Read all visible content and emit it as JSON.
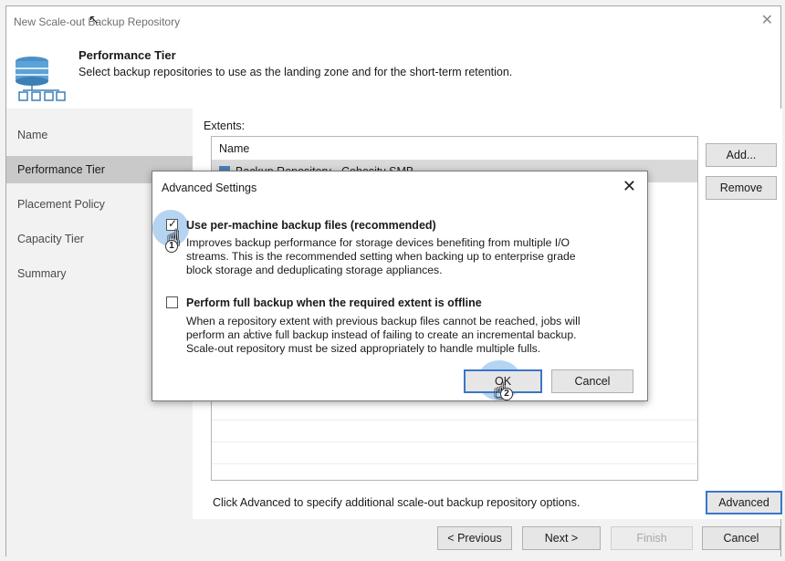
{
  "window": {
    "title": "New Scale-out Backup Repository",
    "close_icon": "close-icon"
  },
  "header": {
    "title": "Performance Tier",
    "subtitle": "Select backup repositories to use as the landing zone and for the short-term retention."
  },
  "sidebar": {
    "items": [
      {
        "label": "Name"
      },
      {
        "label": "Performance Tier"
      },
      {
        "label": "Placement Policy"
      },
      {
        "label": "Capacity Tier"
      },
      {
        "label": "Summary"
      }
    ],
    "active_index": 1
  },
  "main": {
    "extents_label": "Extents:",
    "list": {
      "column_header": "Name",
      "rows": [
        {
          "name": "Backup Repository - Cohesity SMB"
        }
      ]
    },
    "buttons": {
      "add": "Add...",
      "remove": "Remove",
      "advanced": "Advanced"
    },
    "hint": "Click Advanced to specify additional scale-out backup repository options."
  },
  "footer": {
    "previous": "< Previous",
    "next": "Next >",
    "finish": "Finish",
    "cancel": "Cancel"
  },
  "dialog": {
    "title": "Advanced Settings",
    "options": [
      {
        "label": "Use per-machine backup files (recommended)",
        "checked": true,
        "description": [
          "Improves backup performance for storage devices benefiting from multiple I/O",
          "streams. This is the recommended setting when backing up to enterprise grade",
          "block storage and deduplicating storage appliances."
        ]
      },
      {
        "label": "Perform full backup when the required extent is offline",
        "checked": false,
        "description": [
          "When a repository extent with previous backup files cannot be reached, jobs will",
          "perform an active full backup instead of failing to create an incremental backup.",
          "Scale-out repository must be sized appropriately to handle multiple fulls."
        ]
      }
    ],
    "ok": "OK",
    "cancel": "Cancel"
  },
  "annotations": {
    "step1": "1",
    "step2": "2"
  },
  "colors": {
    "accent": "#3a76c9",
    "highlight": "#5aa0e1",
    "sidebar_active": "#c9c9c9",
    "repository_icon": "#4a7fb5"
  }
}
